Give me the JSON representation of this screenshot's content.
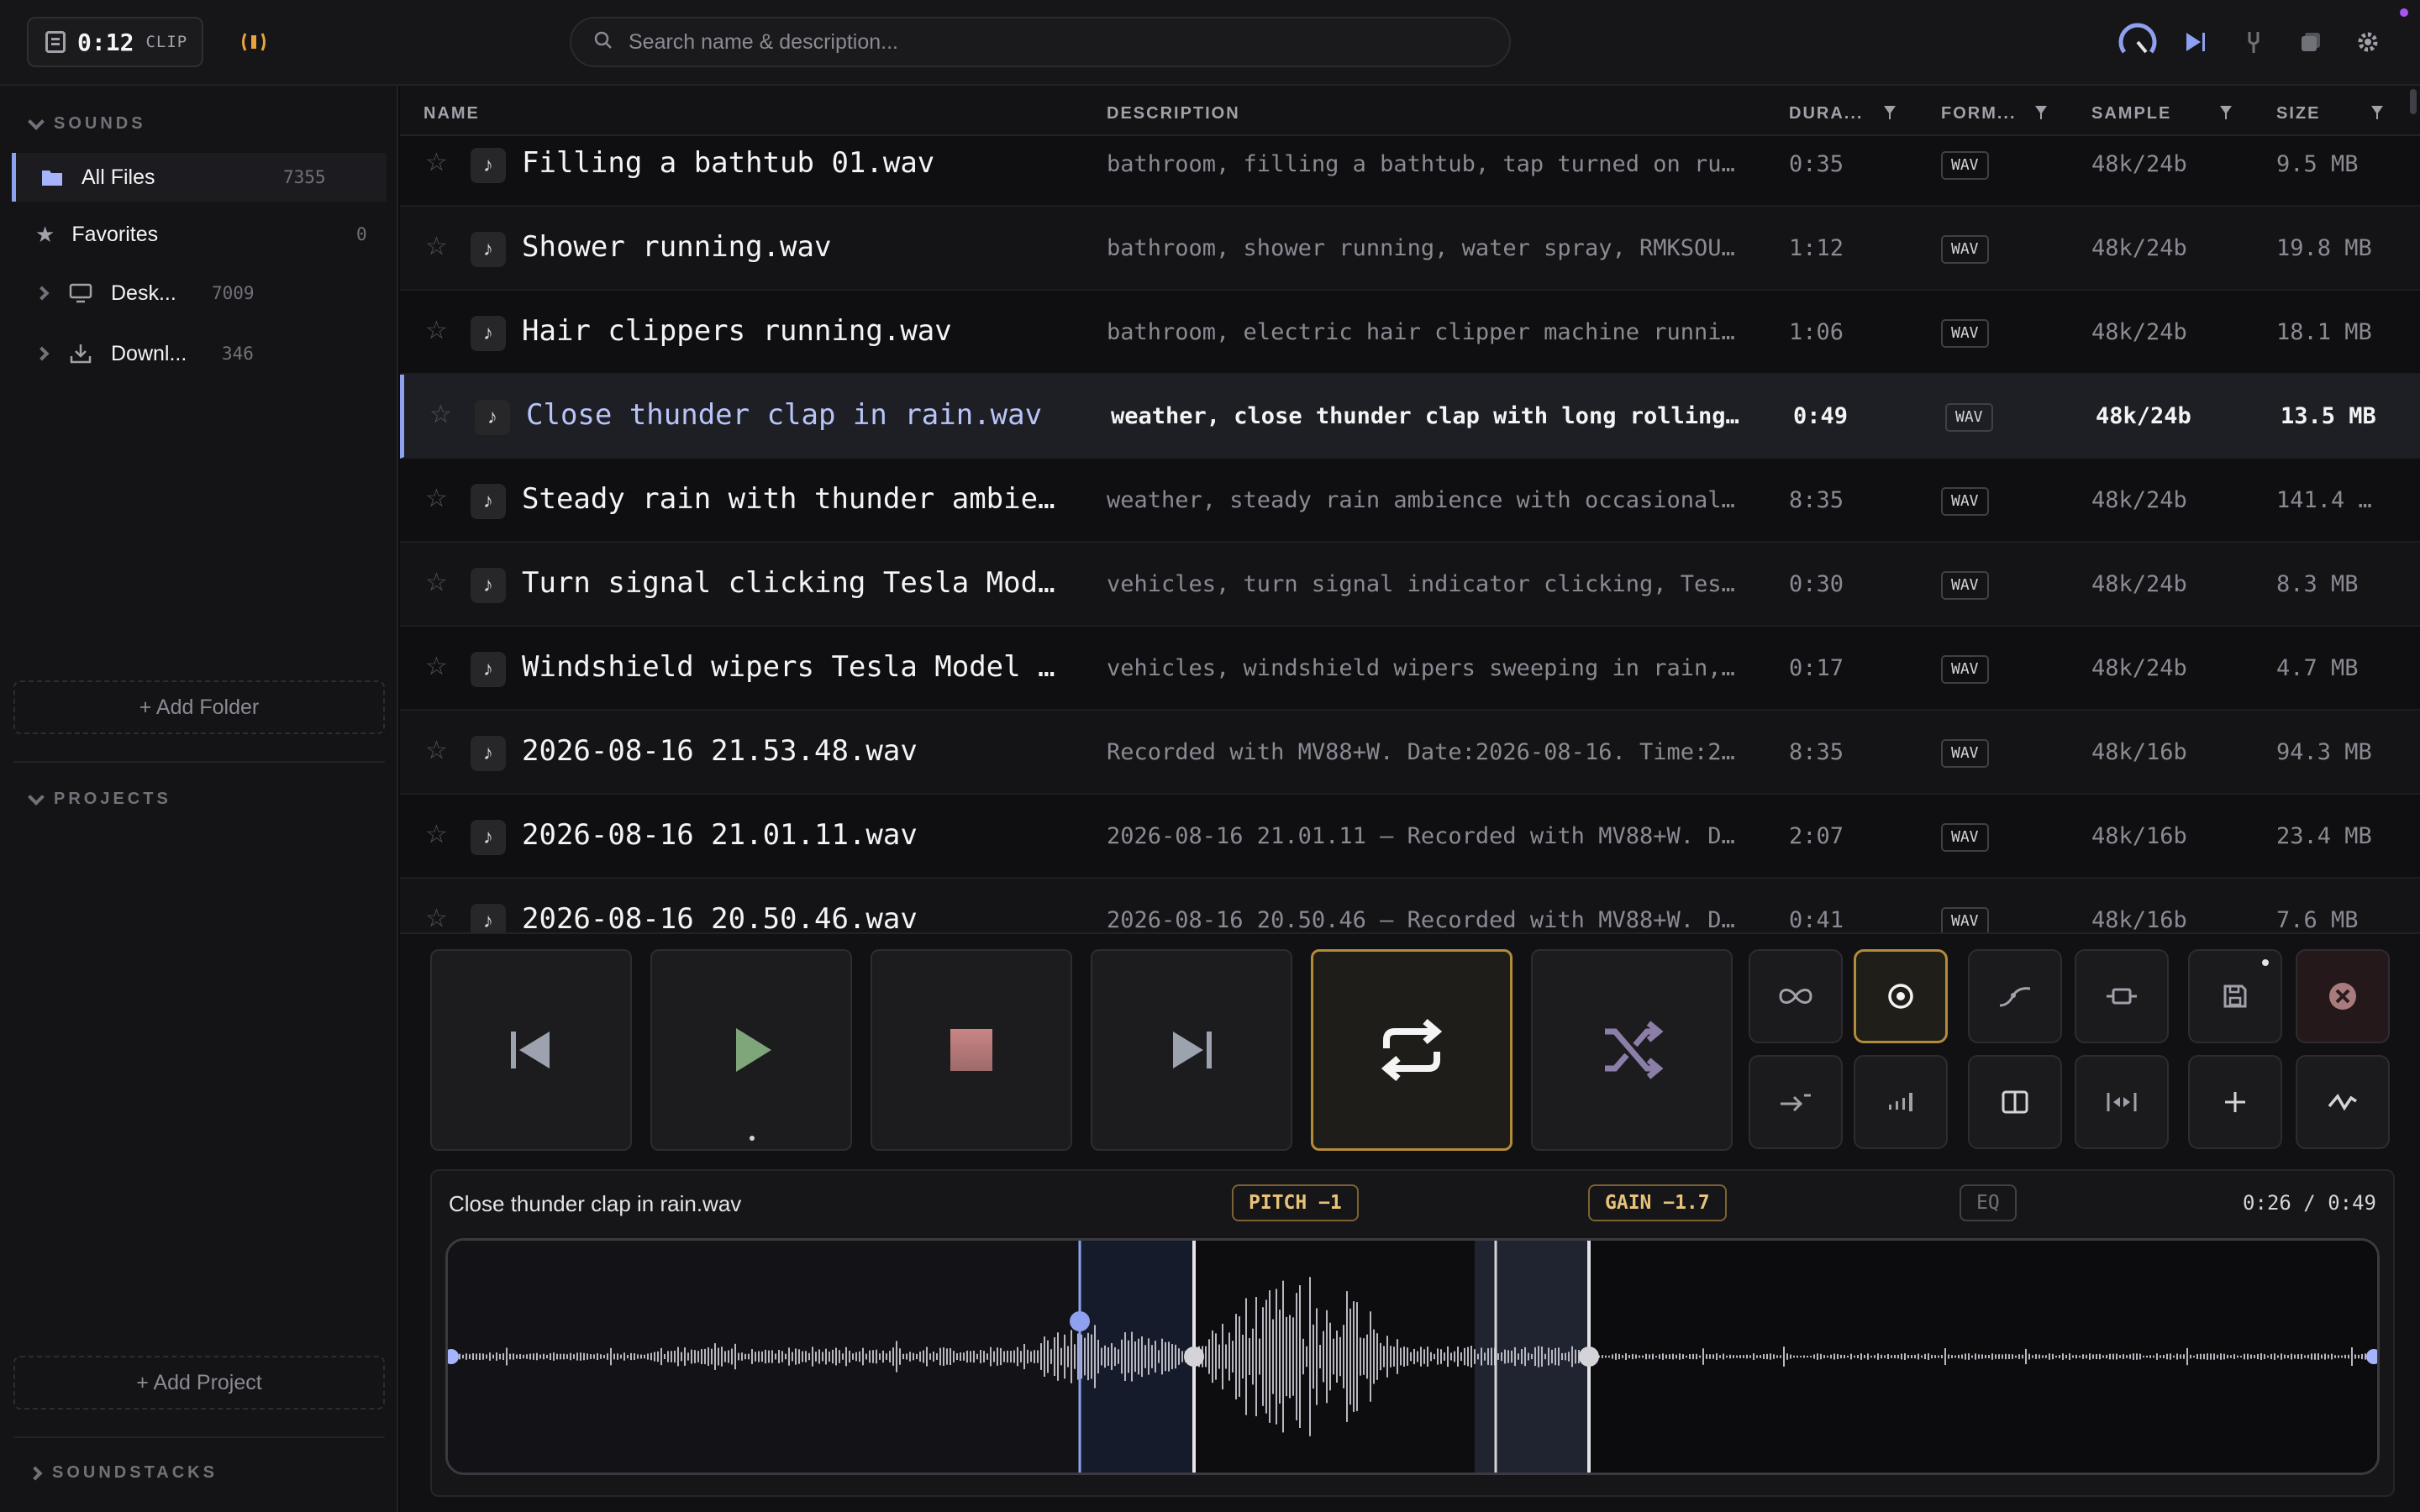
{
  "topbar": {
    "clip_time": "0:12",
    "clip_label": "CLIP",
    "search_placeholder": "Search name & description..."
  },
  "sidebar": {
    "sounds_header": "SOUNDS",
    "items": [
      {
        "label": "All Files",
        "count": "7355"
      },
      {
        "label": "Favorites",
        "count": "0"
      },
      {
        "label": "Desk...",
        "count": "7009"
      },
      {
        "label": "Downl...",
        "count": "346"
      }
    ],
    "add_folder": "+ Add Folder",
    "projects_header": "PROJECTS",
    "add_project": "+ Add Project",
    "soundstacks_header": "SOUNDSTACKS"
  },
  "table": {
    "headers": {
      "name": "NAME",
      "description": "DESCRIPTION",
      "duration": "DURA...",
      "format": "FORM...",
      "sample": "SAMPLE",
      "size": "SIZE"
    },
    "rows": [
      {
        "name": "Filling a bathtub 01.wav",
        "description": "bathroom, filling a bathtub, tap turned on ru…",
        "duration": "0:35",
        "format": "WAV",
        "sample": "48k/24b",
        "size": "9.5 MB"
      },
      {
        "name": "Shower running.wav",
        "description": "bathroom, shower running, water spray, RMKSOU…",
        "duration": "1:12",
        "format": "WAV",
        "sample": "48k/24b",
        "size": "19.8 MB"
      },
      {
        "name": "Hair clippers running.wav",
        "description": "bathroom, electric hair clipper machine runni…",
        "duration": "1:06",
        "format": "WAV",
        "sample": "48k/24b",
        "size": "18.1 MB"
      },
      {
        "name": "Close thunder clap in rain.wav",
        "description": "weather, close thunder clap with long rolling…",
        "duration": "0:49",
        "format": "WAV",
        "sample": "48k/24b",
        "size": "13.5 MB"
      },
      {
        "name": "Steady rain with thunder ambience…",
        "description": "weather, steady rain ambience with occasional…",
        "duration": "8:35",
        "format": "WAV",
        "sample": "48k/24b",
        "size": "141.4 …"
      },
      {
        "name": "Turn signal clicking Tesla Model …",
        "description": "vehicles, turn signal indicator clicking, Tes…",
        "duration": "0:30",
        "format": "WAV",
        "sample": "48k/24b",
        "size": "8.3 MB"
      },
      {
        "name": "Windshield wipers Tesla Model Y.w…",
        "description": "vehicles, windshield wipers sweeping in rain,…",
        "duration": "0:17",
        "format": "WAV",
        "sample": "48k/24b",
        "size": "4.7 MB"
      },
      {
        "name": "2026-08-16 21.53.48.wav",
        "description": "Recorded with MV88+W. Date:2026-08-16. Time:2…",
        "duration": "8:35",
        "format": "WAV",
        "sample": "48k/16b",
        "size": "94.3 MB"
      },
      {
        "name": "2026-08-16 21.01.11.wav",
        "description": "2026-08-16 21.01.11 — Recorded with MV88+W. D…",
        "duration": "2:07",
        "format": "WAV",
        "sample": "48k/16b",
        "size": "23.4 MB"
      },
      {
        "name": "2026-08-16 20.50.46.wav",
        "description": "2026-08-16 20.50.46 — Recorded with MV88+W. D…",
        "duration": "0:41",
        "format": "WAV",
        "sample": "48k/16b",
        "size": "7.6 MB"
      }
    ],
    "selected_index": 3
  },
  "player": {
    "now_playing": "Close thunder clap in rain.wav",
    "pitch": "PITCH −1",
    "gain": "GAIN −1.7",
    "eq": "EQ",
    "time": "0:26 / 0:49",
    "position": 0.53,
    "loop_active": true,
    "record_active": true
  },
  "colors": {
    "accent": "#8ea1f0",
    "active_border": "#b38b3a",
    "chip_text": "#e8c27a",
    "signal_icon": "#e8a33d"
  }
}
